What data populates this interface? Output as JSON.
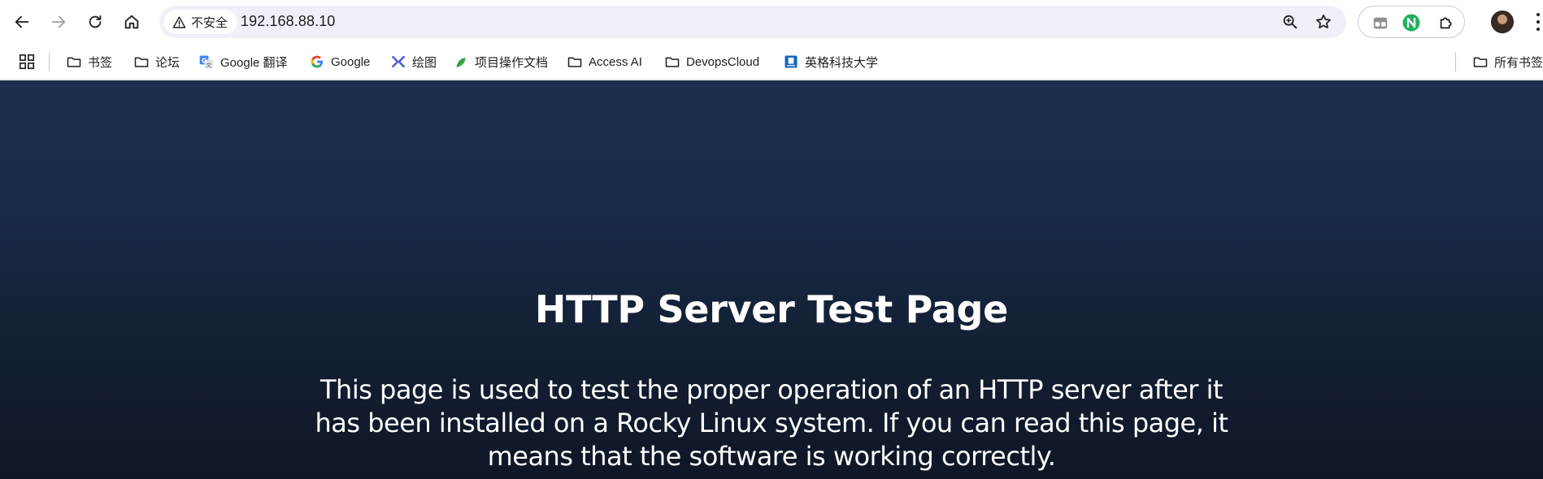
{
  "browser": {
    "security_label": "不安全",
    "url": "192.168.88.10",
    "icons": {
      "back": "arrow-left-icon",
      "forward": "arrow-right-icon",
      "reload": "reload-icon",
      "home": "home-icon",
      "warning": "warning-triangle-icon",
      "zoom": "zoom-icon",
      "bookmark_star": "star-icon",
      "extensions": "puzzle-icon",
      "menu": "kebab-menu-icon"
    }
  },
  "bookmarks": {
    "items": [
      {
        "label": "书签",
        "icon": "folder-icon"
      },
      {
        "label": "论坛",
        "icon": "folder-icon"
      },
      {
        "label": "Google 翻译",
        "icon": "google-translate-icon"
      },
      {
        "label": "Google",
        "icon": "google-icon"
      },
      {
        "label": "绘图",
        "icon": "drawing-icon"
      },
      {
        "label": "项目操作文档",
        "icon": "leaf-icon"
      },
      {
        "label": "Access AI",
        "icon": "folder-icon"
      },
      {
        "label": "DevopsCloud",
        "icon": "folder-icon"
      },
      {
        "label": "英格科技大学",
        "icon": "university-icon"
      }
    ],
    "other_folder_label": "所有书签"
  },
  "page": {
    "title": "HTTP Server Test Page",
    "description": "This page is used to test the proper operation of an HTTP server after it has been installed on a Rocky Linux system. If you can read this page, it means that the software is working correctly."
  },
  "colors": {
    "page_bg_top": "#1c2f4e",
    "page_bg_bottom": "#0f1726",
    "omnibox_bg": "#eef1f8",
    "extension_green": "#20b15a"
  }
}
